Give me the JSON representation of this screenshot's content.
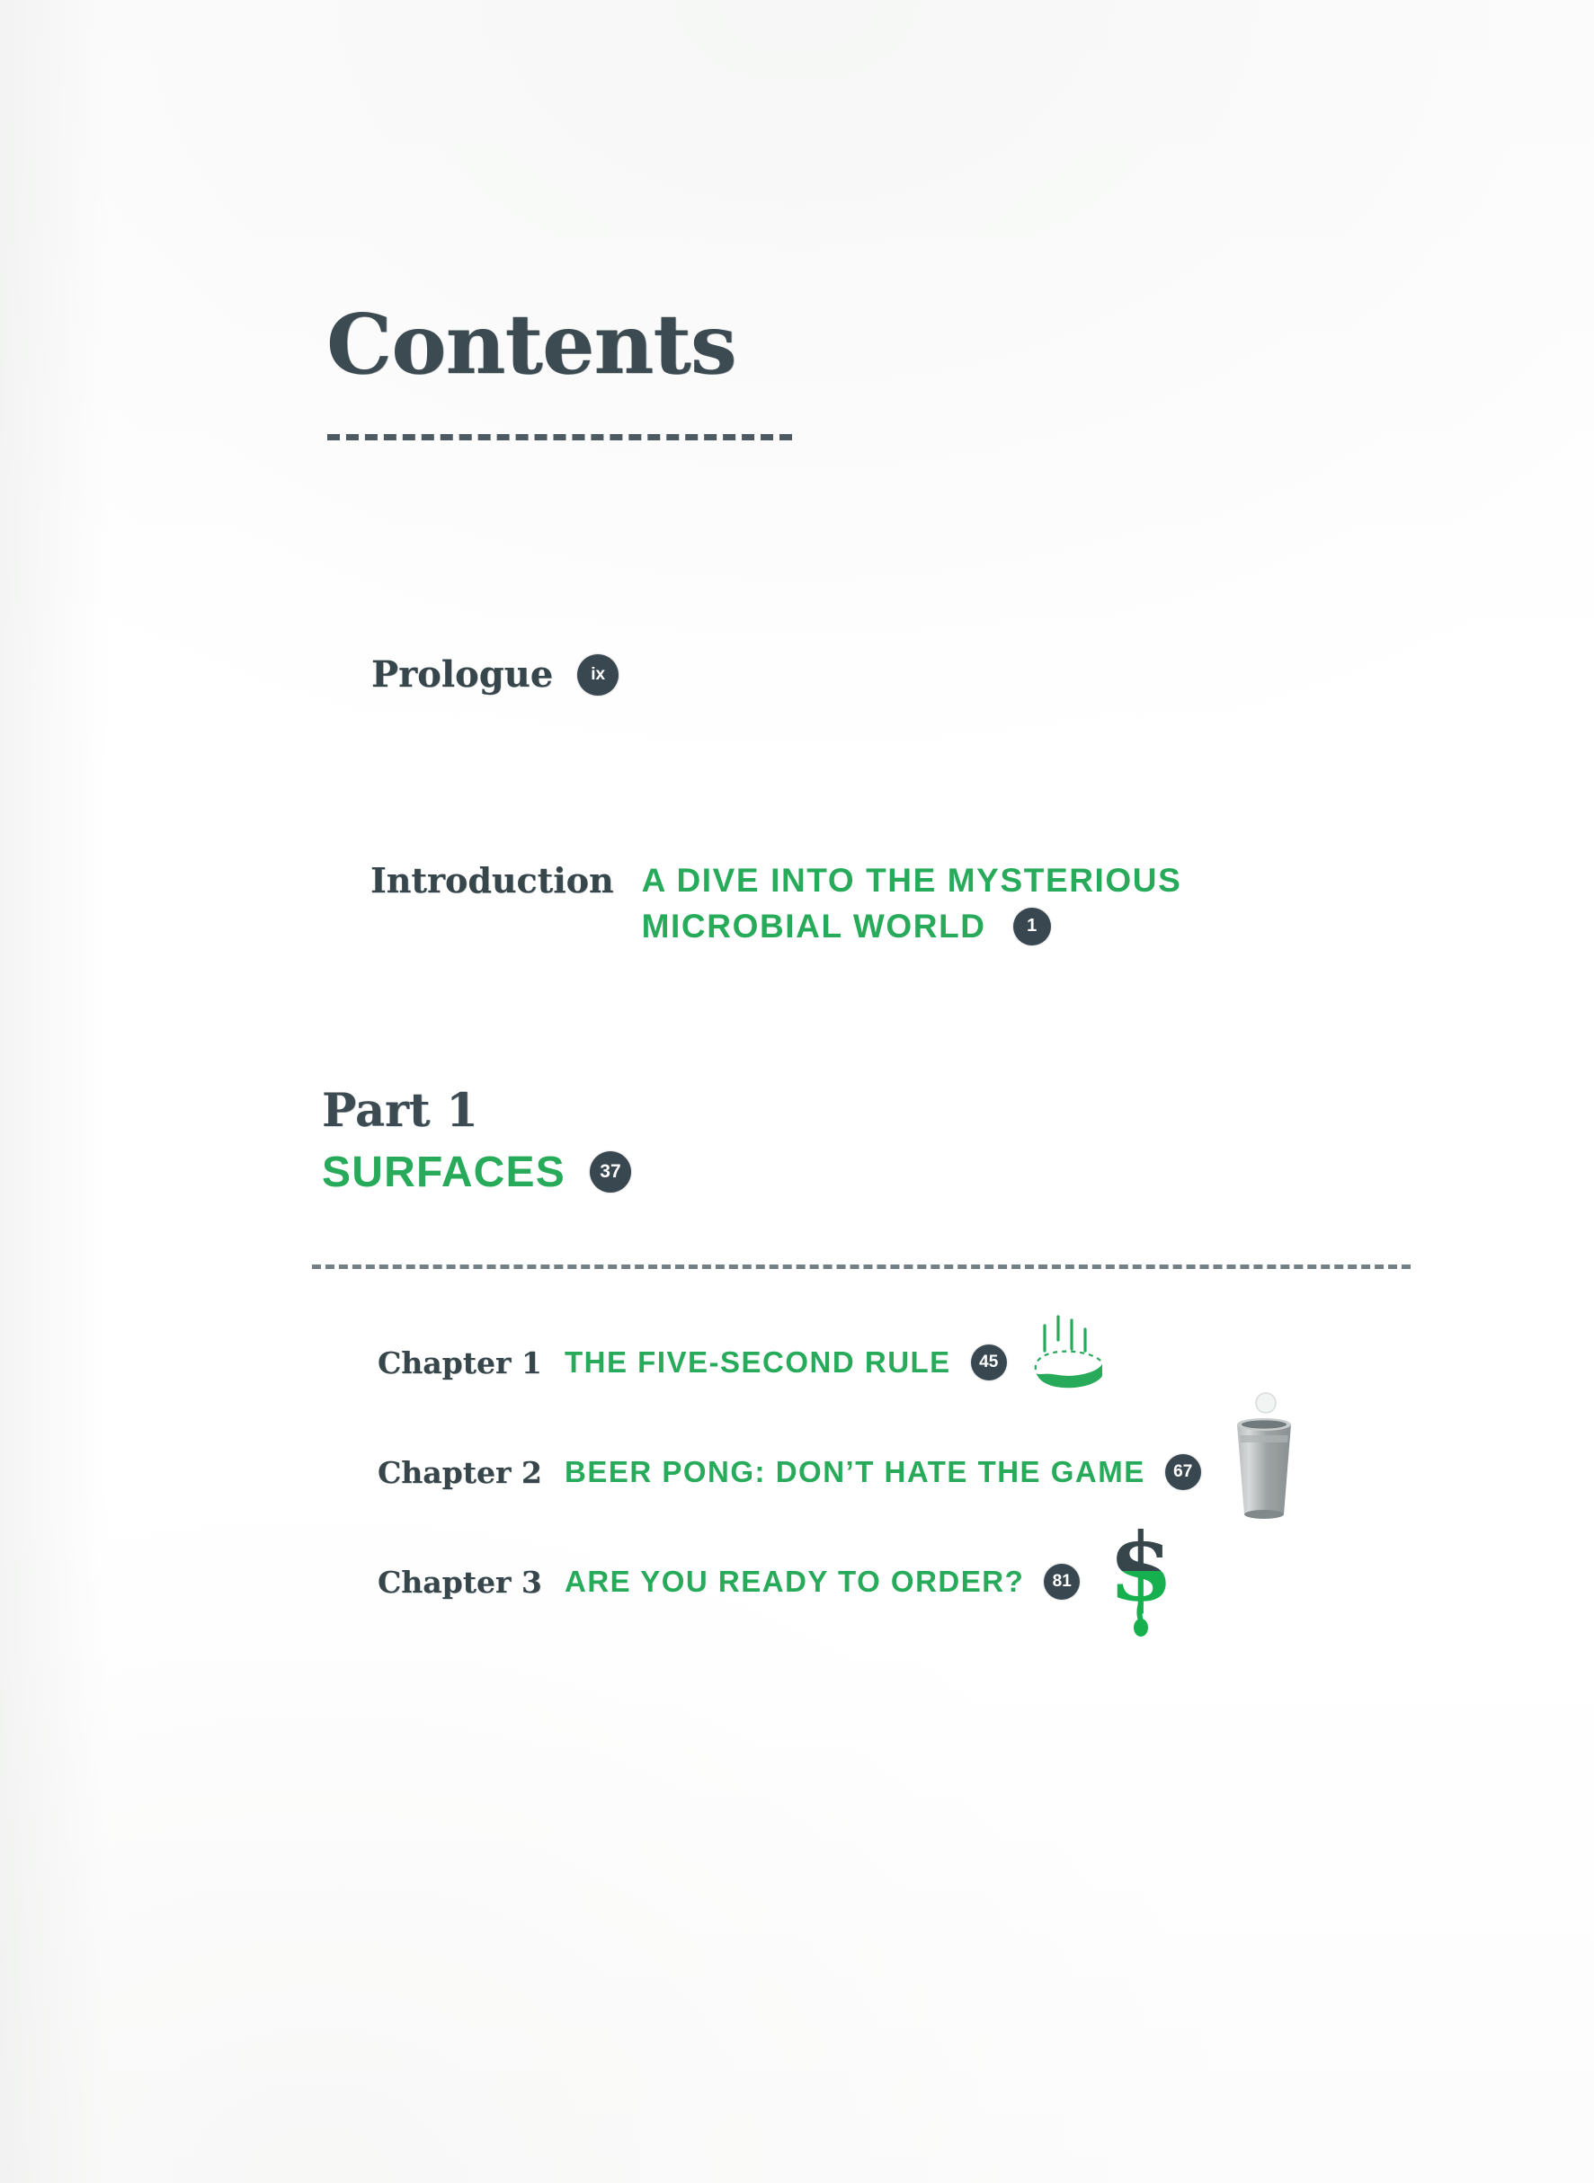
{
  "page": {
    "title": "Contents",
    "background_color": "#ffffff",
    "accent_green": "#27ab5a",
    "dark_slate": "#37464a"
  },
  "front_matter": [
    {
      "label": "Prologue",
      "title": "",
      "page": "ix"
    },
    {
      "label": "Introduction",
      "title_line1": "A DIVE INTO THE MYSTERIOUS",
      "title_line2": "MICROBIAL WORLD",
      "page": "1"
    }
  ],
  "part": {
    "label": "Part 1",
    "name": "SURFACES",
    "page": "37"
  },
  "chapters": [
    {
      "label": "Chapter 1",
      "title": "THE FIVE-SECOND RULE",
      "page": "45",
      "icon": "bread-slice-icon"
    },
    {
      "label": "Chapter 2",
      "title": "BEER PONG: DON’T HATE THE GAME",
      "page": "67",
      "icon": "party-cup-icon"
    },
    {
      "label": "Chapter 3",
      "title": "ARE YOU READY TO ORDER?",
      "page": "81",
      "icon": "dripping-dollar-sign-icon"
    }
  ]
}
